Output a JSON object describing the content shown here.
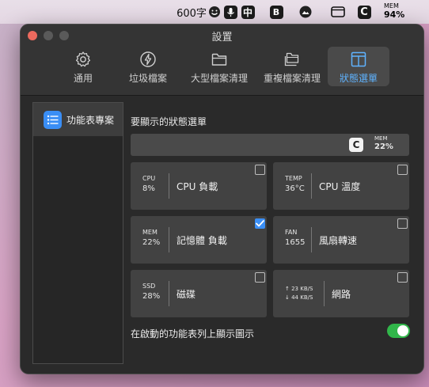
{
  "menubar": {
    "input_status": "600字",
    "mem": {
      "label": "MEM",
      "value": "94%"
    }
  },
  "window": {
    "title": "設置",
    "tabs": [
      {
        "label": "通用",
        "icon": "gear-icon"
      },
      {
        "label": "垃圾檔案",
        "icon": "lightning-icon"
      },
      {
        "label": "大型檔案清理",
        "icon": "folder-icon"
      },
      {
        "label": "重複檔案清理",
        "icon": "duplicate-folder-icon"
      },
      {
        "label": "狀態選單",
        "icon": "layout-icon",
        "active": true
      }
    ]
  },
  "sidebar": {
    "items": [
      {
        "label": "功能表專案",
        "icon": "list-icon",
        "selected": true
      }
    ]
  },
  "main": {
    "section_title": "要顯示的狀態選單",
    "preview": {
      "mem_label": "MEM",
      "mem_value": "22%"
    },
    "items": [
      {
        "key": "CPU",
        "value": "8%",
        "name": "CPU 負載",
        "checked": false
      },
      {
        "key": "TEMP",
        "value": "36°C",
        "name": "CPU 溫度",
        "checked": false
      },
      {
        "key": "MEM",
        "value": "22%",
        "name": "記憶體 負載",
        "checked": true
      },
      {
        "key": "FAN",
        "value": "1655",
        "name": "風扇轉速",
        "checked": false
      },
      {
        "key": "SSD",
        "value": "28%",
        "name": "磁碟",
        "checked": false
      },
      {
        "up": "↑ 23 KB/S",
        "down": "↓ 44 KB/S",
        "name": "網路",
        "checked": false
      }
    ],
    "toggle": {
      "label": "在啟動的功能表列上顯示圖示",
      "on": true
    }
  },
  "colors": {
    "accent": "#3b8ff6",
    "active_tab": "#5fb3ff",
    "toggle_on": "#31b64a",
    "close": "#ec6a5e"
  }
}
